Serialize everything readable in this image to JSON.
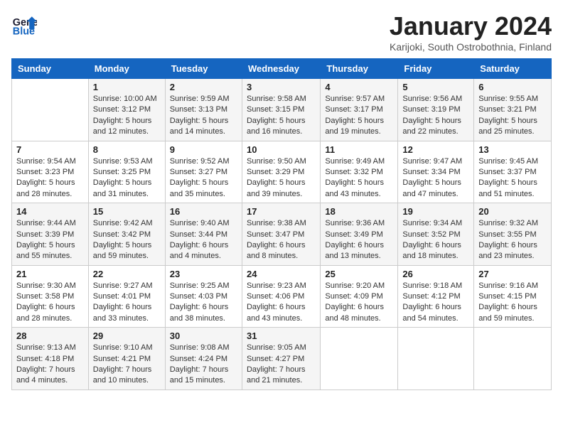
{
  "header": {
    "logo_line1": "General",
    "logo_line2": "Blue",
    "month_title": "January 2024",
    "subtitle": "Karijoki, South Ostrobothnia, Finland"
  },
  "days_of_week": [
    "Sunday",
    "Monday",
    "Tuesday",
    "Wednesday",
    "Thursday",
    "Friday",
    "Saturday"
  ],
  "weeks": [
    [
      {
        "day": "",
        "info": ""
      },
      {
        "day": "1",
        "info": "Sunrise: 10:00 AM\nSunset: 3:12 PM\nDaylight: 5 hours\nand 12 minutes."
      },
      {
        "day": "2",
        "info": "Sunrise: 9:59 AM\nSunset: 3:13 PM\nDaylight: 5 hours\nand 14 minutes."
      },
      {
        "day": "3",
        "info": "Sunrise: 9:58 AM\nSunset: 3:15 PM\nDaylight: 5 hours\nand 16 minutes."
      },
      {
        "day": "4",
        "info": "Sunrise: 9:57 AM\nSunset: 3:17 PM\nDaylight: 5 hours\nand 19 minutes."
      },
      {
        "day": "5",
        "info": "Sunrise: 9:56 AM\nSunset: 3:19 PM\nDaylight: 5 hours\nand 22 minutes."
      },
      {
        "day": "6",
        "info": "Sunrise: 9:55 AM\nSunset: 3:21 PM\nDaylight: 5 hours\nand 25 minutes."
      }
    ],
    [
      {
        "day": "7",
        "info": "Sunrise: 9:54 AM\nSunset: 3:23 PM\nDaylight: 5 hours\nand 28 minutes."
      },
      {
        "day": "8",
        "info": "Sunrise: 9:53 AM\nSunset: 3:25 PM\nDaylight: 5 hours\nand 31 minutes."
      },
      {
        "day": "9",
        "info": "Sunrise: 9:52 AM\nSunset: 3:27 PM\nDaylight: 5 hours\nand 35 minutes."
      },
      {
        "day": "10",
        "info": "Sunrise: 9:50 AM\nSunset: 3:29 PM\nDaylight: 5 hours\nand 39 minutes."
      },
      {
        "day": "11",
        "info": "Sunrise: 9:49 AM\nSunset: 3:32 PM\nDaylight: 5 hours\nand 43 minutes."
      },
      {
        "day": "12",
        "info": "Sunrise: 9:47 AM\nSunset: 3:34 PM\nDaylight: 5 hours\nand 47 minutes."
      },
      {
        "day": "13",
        "info": "Sunrise: 9:45 AM\nSunset: 3:37 PM\nDaylight: 5 hours\nand 51 minutes."
      }
    ],
    [
      {
        "day": "14",
        "info": "Sunrise: 9:44 AM\nSunset: 3:39 PM\nDaylight: 5 hours\nand 55 minutes."
      },
      {
        "day": "15",
        "info": "Sunrise: 9:42 AM\nSunset: 3:42 PM\nDaylight: 5 hours\nand 59 minutes."
      },
      {
        "day": "16",
        "info": "Sunrise: 9:40 AM\nSunset: 3:44 PM\nDaylight: 6 hours\nand 4 minutes."
      },
      {
        "day": "17",
        "info": "Sunrise: 9:38 AM\nSunset: 3:47 PM\nDaylight: 6 hours\nand 8 minutes."
      },
      {
        "day": "18",
        "info": "Sunrise: 9:36 AM\nSunset: 3:49 PM\nDaylight: 6 hours\nand 13 minutes."
      },
      {
        "day": "19",
        "info": "Sunrise: 9:34 AM\nSunset: 3:52 PM\nDaylight: 6 hours\nand 18 minutes."
      },
      {
        "day": "20",
        "info": "Sunrise: 9:32 AM\nSunset: 3:55 PM\nDaylight: 6 hours\nand 23 minutes."
      }
    ],
    [
      {
        "day": "21",
        "info": "Sunrise: 9:30 AM\nSunset: 3:58 PM\nDaylight: 6 hours\nand 28 minutes."
      },
      {
        "day": "22",
        "info": "Sunrise: 9:27 AM\nSunset: 4:01 PM\nDaylight: 6 hours\nand 33 minutes."
      },
      {
        "day": "23",
        "info": "Sunrise: 9:25 AM\nSunset: 4:03 PM\nDaylight: 6 hours\nand 38 minutes."
      },
      {
        "day": "24",
        "info": "Sunrise: 9:23 AM\nSunset: 4:06 PM\nDaylight: 6 hours\nand 43 minutes."
      },
      {
        "day": "25",
        "info": "Sunrise: 9:20 AM\nSunset: 4:09 PM\nDaylight: 6 hours\nand 48 minutes."
      },
      {
        "day": "26",
        "info": "Sunrise: 9:18 AM\nSunset: 4:12 PM\nDaylight: 6 hours\nand 54 minutes."
      },
      {
        "day": "27",
        "info": "Sunrise: 9:16 AM\nSunset: 4:15 PM\nDaylight: 6 hours\nand 59 minutes."
      }
    ],
    [
      {
        "day": "28",
        "info": "Sunrise: 9:13 AM\nSunset: 4:18 PM\nDaylight: 7 hours\nand 4 minutes."
      },
      {
        "day": "29",
        "info": "Sunrise: 9:10 AM\nSunset: 4:21 PM\nDaylight: 7 hours\nand 10 minutes."
      },
      {
        "day": "30",
        "info": "Sunrise: 9:08 AM\nSunset: 4:24 PM\nDaylight: 7 hours\nand 15 minutes."
      },
      {
        "day": "31",
        "info": "Sunrise: 9:05 AM\nSunset: 4:27 PM\nDaylight: 7 hours\nand 21 minutes."
      },
      {
        "day": "",
        "info": ""
      },
      {
        "day": "",
        "info": ""
      },
      {
        "day": "",
        "info": ""
      }
    ]
  ]
}
